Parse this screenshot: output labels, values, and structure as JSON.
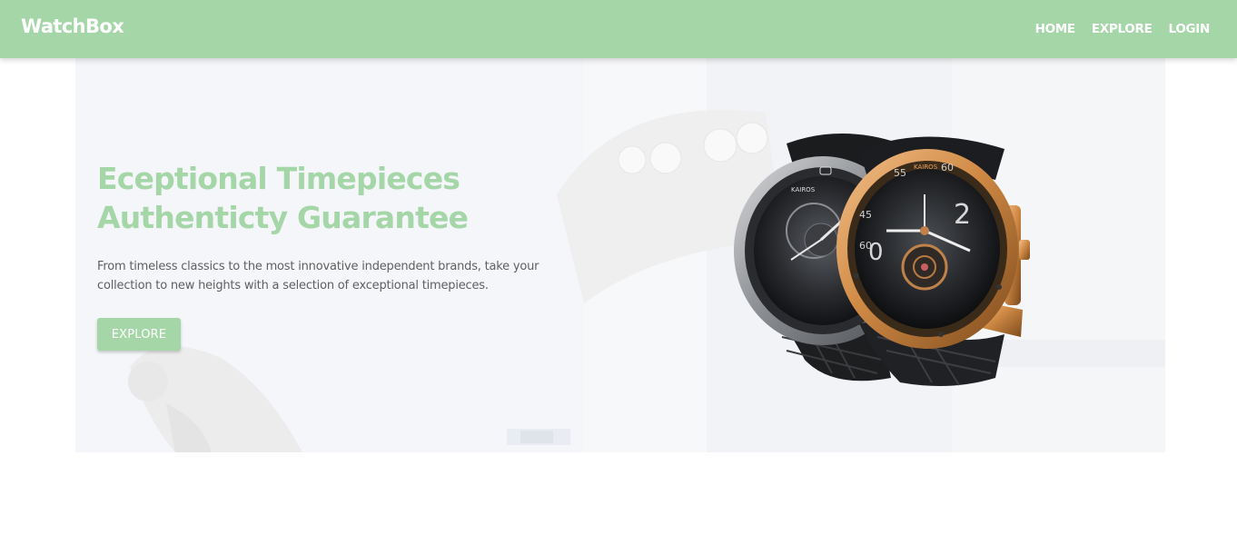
{
  "navbar": {
    "brand": "WatchBox",
    "links": [
      "HOME",
      "EXPLORE",
      "LOGIN"
    ]
  },
  "hero": {
    "headline_line1": "Eceptional Timepieces",
    "headline_line2": "Authenticty Guarantee",
    "description": "From timeless classics to the most innovative independent brands, take your collection to new heights with a selection of exceptional timepieces.",
    "button_label": "EXPLORE",
    "image_alt": "Two Kairos watches, one black and one gold",
    "watch_brand_text": "KAIROS"
  },
  "colors": {
    "accent": "#a5d6a7",
    "nav_text": "#ffffff",
    "body_text": "#5f5f5f",
    "hero_bg": "#f7f8fa"
  },
  "icons": {
    "hero_image": "watch-pair-image"
  }
}
